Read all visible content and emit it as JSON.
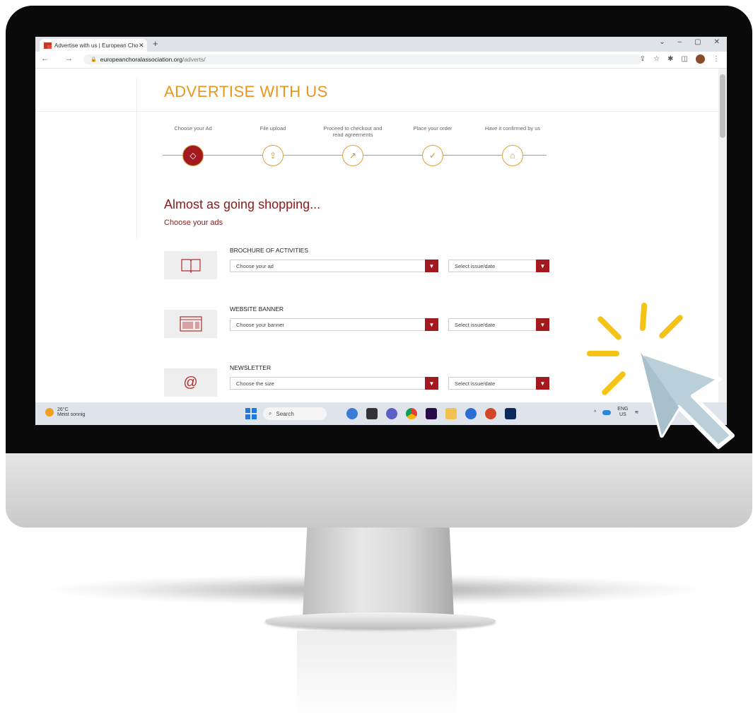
{
  "browser": {
    "tab_title": "Advertise with us | European Cho",
    "tab_close": "✕",
    "new_tab": "+",
    "url_host": "europeanchoralassociation.org",
    "url_path": "/adverts/",
    "nav_buttons": "← → C",
    "window_buttons": [
      "⌄",
      "–",
      "▢",
      "✕"
    ]
  },
  "page": {
    "title": "ADVERTISE WITH US",
    "steps": [
      {
        "label": "Choose your Ad",
        "icon": "⌂"
      },
      {
        "label": "File upload",
        "icon": "⇪"
      },
      {
        "label": "Proceed to checkout and read agreements",
        "icon": "↗"
      },
      {
        "label": "Place your order",
        "icon": "✓"
      },
      {
        "label": "Have it confirmed by us",
        "icon": "⌂"
      }
    ],
    "heading": "Almost as going shopping...",
    "subheading": "Choose your ads",
    "ads": [
      {
        "name": "BROCHURE OF ACTIVITIES",
        "icon": "book-icon",
        "select_a": "Choose your ad",
        "select_b": "Select issue/date"
      },
      {
        "name": "WEBSITE BANNER",
        "icon": "banner-icon",
        "select_a": "Choose your banner",
        "select_b": "Select issue/date"
      },
      {
        "name": "NEWSLETTER",
        "icon": "at-icon",
        "select_a": "Choose the size",
        "select_b": "Select issue/date"
      }
    ]
  },
  "taskbar": {
    "temperature": "26°C",
    "weather_text": "Meist sonnig",
    "search_label": "Search",
    "lang_top": "ENG",
    "lang_bottom": "US"
  },
  "colors": {
    "accent_orange": "#e8961e",
    "accent_red": "#a3191f",
    "cursor_color": "#b9cfd9",
    "sparkle_color": "#f5c316"
  }
}
